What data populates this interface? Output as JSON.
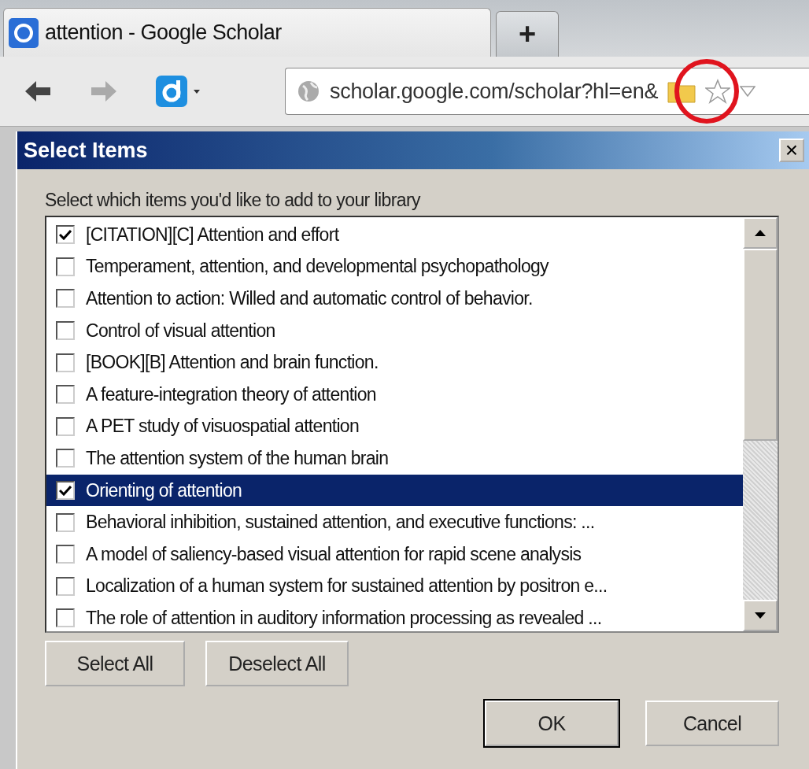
{
  "browser": {
    "tab_title": "attention - Google Scholar",
    "new_tab": "+",
    "address": "scholar.google.com/scholar?hl=en&"
  },
  "dialog": {
    "title": "Select Items",
    "close": "×",
    "prompt": "Select which items you'd like to add to your library",
    "items": [
      {
        "label": "[CITATION][C] Attention and effort",
        "checked": true,
        "selected": false
      },
      {
        "label": "Temperament, attention, and developmental psychopathology",
        "checked": false,
        "selected": false
      },
      {
        "label": "Attention to action: Willed and automatic control of behavior.",
        "checked": false,
        "selected": false
      },
      {
        "label": "Control of visual attention",
        "checked": false,
        "selected": false
      },
      {
        "label": "[BOOK][B] Attention and brain function.",
        "checked": false,
        "selected": false
      },
      {
        "label": "A feature-integration theory of attention",
        "checked": false,
        "selected": false
      },
      {
        "label": "A PET study of visuospatial attention",
        "checked": false,
        "selected": false
      },
      {
        "label": "The attention system of the human brain",
        "checked": false,
        "selected": false
      },
      {
        "label": "Orienting of attention",
        "checked": true,
        "selected": true
      },
      {
        "label": "Behavioral inhibition, sustained attention, and executive functions: ...",
        "checked": false,
        "selected": false
      },
      {
        "label": "A model of saliency-based visual attention for rapid scene analysis",
        "checked": false,
        "selected": false
      },
      {
        "label": "Localization of a human system for sustained attention by positron e...",
        "checked": false,
        "selected": false
      },
      {
        "label": "The role of attention in auditory information processing as revealed ...",
        "checked": false,
        "selected": false
      }
    ],
    "list_buttons": [
      "Select All",
      "Deselect All"
    ],
    "footer_buttons": [
      "OK",
      "Cancel"
    ]
  }
}
